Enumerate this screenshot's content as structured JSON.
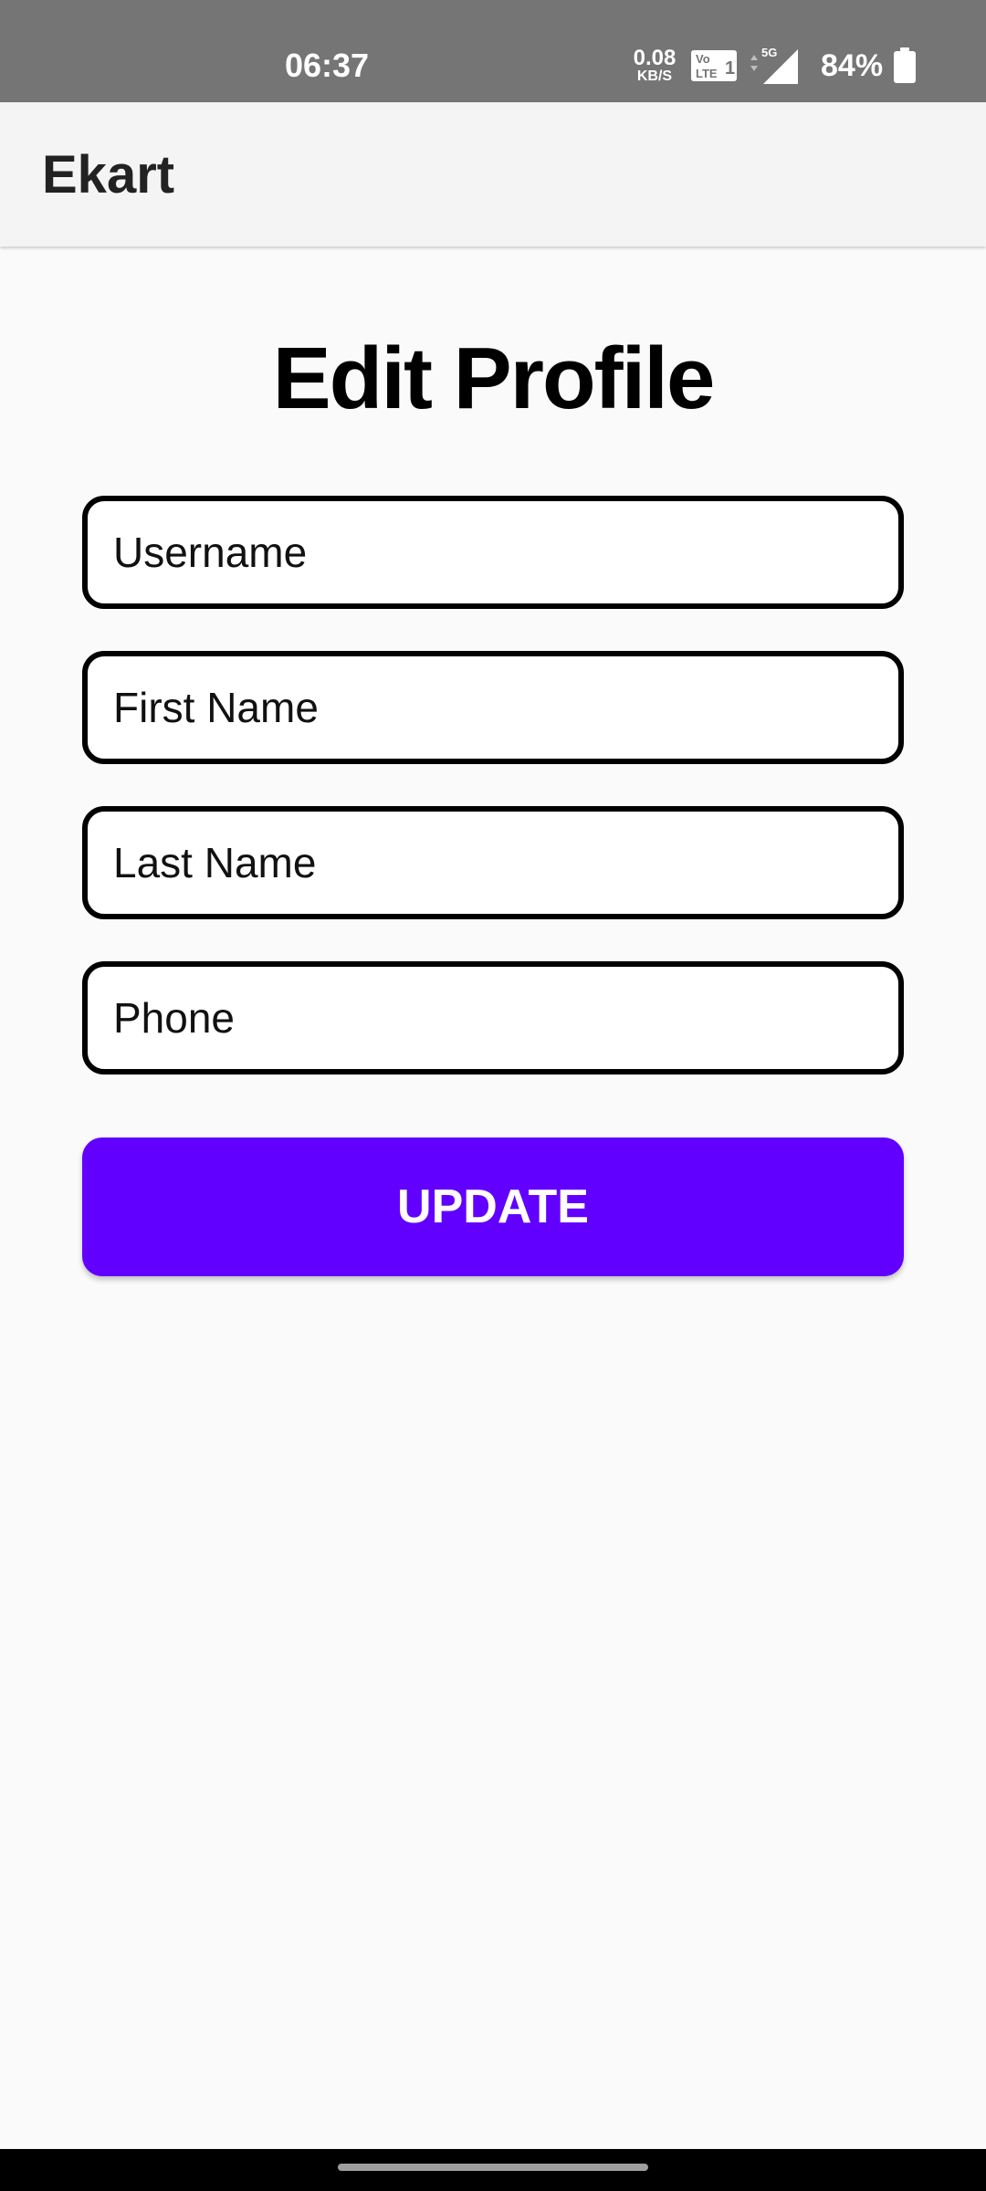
{
  "status_bar": {
    "time": "06:37",
    "net_speed_value": "0.08",
    "net_speed_unit": "KB/S",
    "volte_label": "Vo LTE 1",
    "network_type": "5G",
    "battery_percent": "84%",
    "icons": [
      "volte-icon",
      "signal-icon",
      "battery-icon"
    ]
  },
  "app_bar": {
    "title": "Ekart"
  },
  "main": {
    "page_title": "Edit Profile",
    "fields": {
      "username": {
        "placeholder": "Username",
        "value": ""
      },
      "first_name": {
        "placeholder": "First Name",
        "value": ""
      },
      "last_name": {
        "placeholder": "Last Name",
        "value": ""
      },
      "phone": {
        "placeholder": "Phone",
        "value": ""
      }
    },
    "update_label": "UPDATE"
  },
  "colors": {
    "status_bar": "#757575",
    "app_bar": "#f4f4f4",
    "background": "#fafafa",
    "accent": "#6200ff",
    "field_border": "#000000"
  }
}
